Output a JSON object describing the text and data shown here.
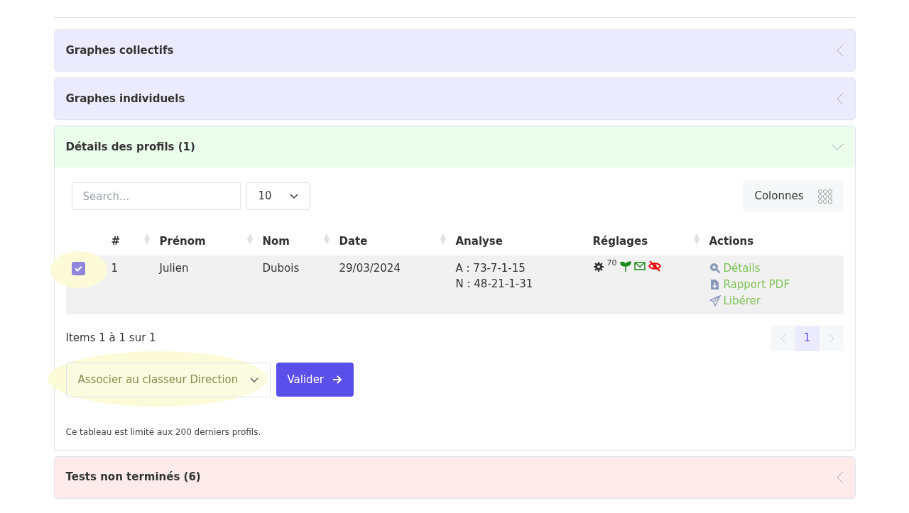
{
  "sections": [
    {
      "title": "Graphes collectifs",
      "expanded": false,
      "color": "#ecebfd"
    },
    {
      "title": "Graphes individuels",
      "expanded": false,
      "color": "#ecebfd"
    },
    {
      "title": "Détails des profils (1)",
      "expanded": true,
      "color": "#ebfdeb"
    },
    {
      "title": "Tests non terminés (6)",
      "expanded": false,
      "color": "#fdebeb"
    }
  ],
  "profiles": {
    "search": {
      "placeholder": "Search..."
    },
    "page_size": "10",
    "columns_button": "Colonnes",
    "columns": [
      {
        "label": "#",
        "sortable": true
      },
      {
        "label": "Prénom",
        "sortable": true
      },
      {
        "label": "Nom",
        "sortable": true
      },
      {
        "label": "Date",
        "sortable": true
      },
      {
        "label": "Analyse",
        "sortable": false
      },
      {
        "label": "Réglages",
        "sortable": true
      },
      {
        "label": "Actions",
        "sortable": false
      }
    ],
    "rows": [
      {
        "checked": true,
        "highlighted": true,
        "number": "1",
        "prenom": "Julien",
        "nom": "Dubois",
        "date": "29/03/2024",
        "analyse": [
          "A : 73-7-1-15",
          "N : 48-21-1-31"
        ],
        "settings_value": "70",
        "actions": [
          "Détails",
          "Rapport PDF",
          "Libérer"
        ]
      }
    ],
    "footer": "Items 1 à 1 sur 1",
    "pages": [
      {
        "label": "1",
        "selected": true
      }
    ],
    "bulk_select": {
      "value": "Associer au classeur Direction",
      "highlighted": true
    },
    "submit": "Valider",
    "note": "Ce tableau est limité aux 200 derniers profils."
  }
}
